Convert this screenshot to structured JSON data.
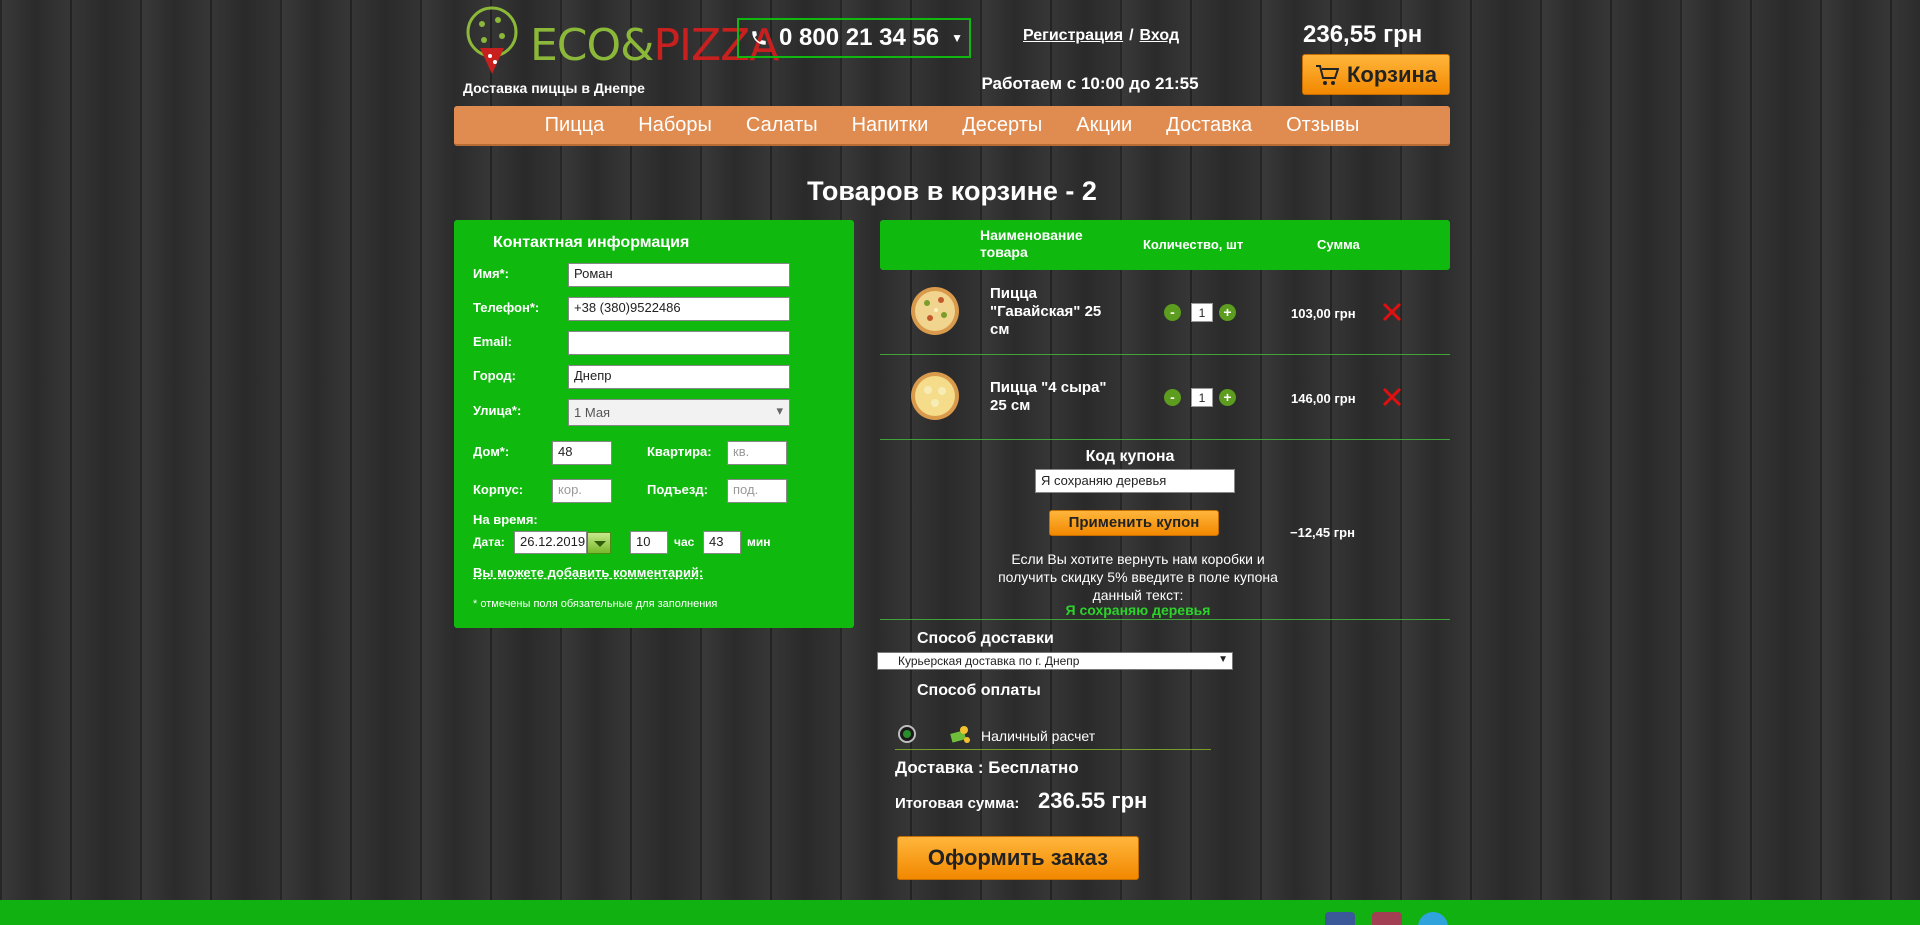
{
  "header": {
    "logo_eco": "ECO",
    "logo_amp": "&",
    "logo_pizza": "PIZZA",
    "tagline": "Доставка пиццы в Днепре",
    "phone": "0 800 21 34 56",
    "register": "Регистрация",
    "separator": "/",
    "login": "Вход",
    "hours": "Работаем с 10:00 до 21:55",
    "cart_total": "236,55 грн",
    "cart_label": "Корзина"
  },
  "nav": [
    "Пицца",
    "Наборы",
    "Салаты",
    "Напитки",
    "Десерты",
    "Акции",
    "Доставка",
    "Отзывы"
  ],
  "cart_title": "Товаров в корзине - 2",
  "contact": {
    "title": "Контактная информация",
    "name_label": "Имя*:",
    "name_value": "Роман",
    "phone_label": "Телефон*:",
    "phone_value": "+38 (380)9522486",
    "email_label": "Email:",
    "email_value": "",
    "city_label": "Город:",
    "city_value": "Днепр",
    "street_label": "Улица*:",
    "street_value": "1 Мая",
    "house_label": "Дом*:",
    "house_value": "48",
    "apt_label": "Квартира:",
    "apt_placeholder": "кв.",
    "block_label": "Корпус:",
    "block_placeholder": "кор.",
    "entrance_label": "Подъезд:",
    "entrance_placeholder": "под.",
    "time_label": "На время:",
    "date_label": "Дата:",
    "date_value": "26.12.2019",
    "hour_value": "10",
    "hour_label": "час",
    "min_value": "43",
    "min_label": "мин",
    "comment_link": "Вы можете добавить комментарий:",
    "required_note": "* отмечены поля обязательные для заполнения"
  },
  "cart": {
    "col_name": "Наименование товара",
    "col_qty": "Количество, шт",
    "col_sum": "Сумма",
    "items": [
      {
        "name": "Пицца \"Гавайская\" 25 см",
        "qty": "1",
        "sum": "103,00 грн",
        "minus": "-",
        "plus": "+"
      },
      {
        "name": "Пицца \"4 сыра\" 25 см",
        "qty": "1",
        "sum": "146,00 грн",
        "minus": "-",
        "plus": "+"
      }
    ],
    "coupon_title": "Код купона",
    "coupon_value": "Я сохраняю деревья",
    "coupon_button": "Применить купон",
    "coupon_discount": "−12,45 грн",
    "coupon_info": "Если Вы хотите вернуть нам коробки и получить скидку 5% введите в поле купона данный текст:",
    "coupon_code": "Я сохраняю деревья",
    "delivery_title": "Способ доставки",
    "delivery_value": "Курьерская доставка по г. Днепр",
    "payment_title": "Способ оплаты",
    "payment_value": "Наличный расчет",
    "delivery_cost": "Доставка : Бесплатно",
    "total_label": "Итоговая сумма:",
    "total_value": "236.55 грн",
    "order_button": "Оформить заказ"
  },
  "colors": {
    "green": "#10b90e",
    "orange": "#f28800",
    "nav": "#e08b4f"
  },
  "icons": [
    "phone-icon",
    "chevron-down-icon",
    "cart-icon",
    "delete-icon",
    "cash-icon",
    "facebook-icon",
    "instagram-icon",
    "telegram-icon"
  ]
}
